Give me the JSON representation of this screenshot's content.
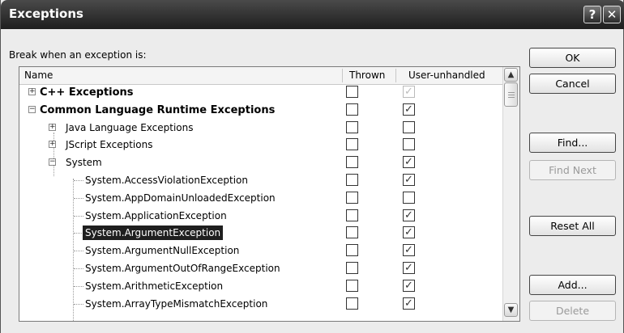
{
  "window": {
    "title": "Exceptions",
    "help_glyph": "?",
    "close_glyph": "✕"
  },
  "prompt": "Break when an exception is:",
  "columns": {
    "name": "Name",
    "thrown": "Thrown",
    "user_unhandled": "User-unhandled"
  },
  "rows": [
    {
      "label": "C++ Exceptions",
      "level": 0,
      "bold": true,
      "expander": "+",
      "thrown": false,
      "user_unhandled": true,
      "user_unhandled_dim": true
    },
    {
      "label": "Common Language Runtime Exceptions",
      "level": 0,
      "bold": true,
      "expander": "−",
      "thrown": false,
      "user_unhandled": true
    },
    {
      "label": "Java Language Exceptions",
      "level": 1,
      "expander": "+",
      "thrown": false,
      "user_unhandled": false
    },
    {
      "label": "JScript Exceptions",
      "level": 1,
      "expander": "+",
      "thrown": false,
      "user_unhandled": false
    },
    {
      "label": "System",
      "level": 1,
      "expander": "−",
      "thrown": false,
      "user_unhandled": true
    },
    {
      "label": "System.AccessViolationException",
      "level": 2,
      "thrown": false,
      "user_unhandled": true
    },
    {
      "label": "System.AppDomainUnloadedException",
      "level": 2,
      "thrown": false,
      "user_unhandled": false
    },
    {
      "label": "System.ApplicationException",
      "level": 2,
      "thrown": false,
      "user_unhandled": true
    },
    {
      "label": "System.ArgumentException",
      "level": 2,
      "selected": true,
      "thrown": false,
      "user_unhandled": true
    },
    {
      "label": "System.ArgumentNullException",
      "level": 2,
      "thrown": false,
      "user_unhandled": true
    },
    {
      "label": "System.ArgumentOutOfRangeException",
      "level": 2,
      "thrown": false,
      "user_unhandled": true
    },
    {
      "label": "System.ArithmeticException",
      "level": 2,
      "thrown": false,
      "user_unhandled": true
    },
    {
      "label": "System.ArrayTypeMismatchException",
      "level": 2,
      "thrown": false,
      "user_unhandled": true
    }
  ],
  "buttons": {
    "ok": "OK",
    "cancel": "Cancel",
    "find": "Find...",
    "find_next": "Find Next",
    "reset_all": "Reset All",
    "add": "Add...",
    "delete": "Delete"
  },
  "icons": {
    "scroll_up": "▲",
    "scroll_down": "▼",
    "check": "✓"
  }
}
